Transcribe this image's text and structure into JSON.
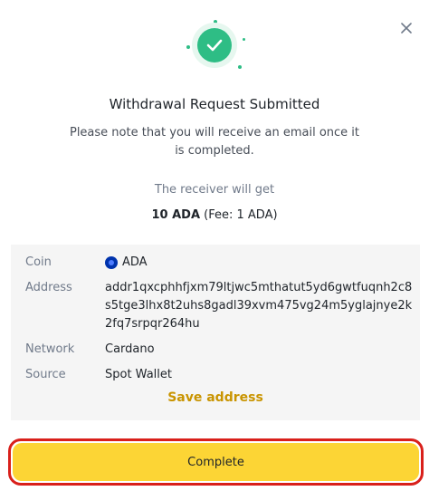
{
  "title": "Withdrawal Request Submitted",
  "note": "Please note that you will receive an email once it is completed.",
  "receiver_label": "The receiver will get",
  "amount": "10 ADA",
  "fee": "(Fee: 1 ADA)",
  "details": {
    "coin": {
      "label": "Coin",
      "value": "ADA"
    },
    "address": {
      "label": "Address",
      "value": "addr1qxcphhfjxm79ltjwc5mthatut5yd6gwtfuqnh2c8s5tge3lhx8t2uhs8gadl39xvm475vg24m5yglajnye2k2fq7srpqr264hu"
    },
    "network": {
      "label": "Network",
      "value": "Cardano"
    },
    "source": {
      "label": "Source",
      "value": "Spot Wallet"
    }
  },
  "save_address_label": "Save address",
  "complete_label": "Complete",
  "icons": {
    "close": "close-icon",
    "success": "check-circle-icon",
    "coin": "ada-coin-icon"
  },
  "colors": {
    "success_green": "#2ebd85",
    "accent_yellow": "#fcd535",
    "link_gold": "#c99400",
    "highlight_red": "#d9201b"
  }
}
